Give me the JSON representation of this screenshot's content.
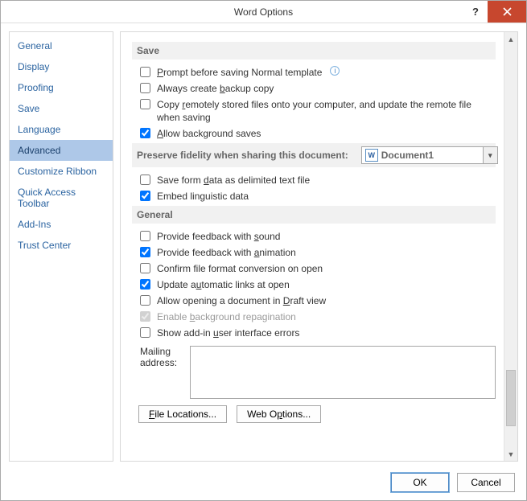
{
  "title": "Word Options",
  "sidebar": {
    "items": [
      {
        "label": "General"
      },
      {
        "label": "Display"
      },
      {
        "label": "Proofing"
      },
      {
        "label": "Save"
      },
      {
        "label": "Language"
      },
      {
        "label": "Advanced",
        "selected": true
      },
      {
        "label": "Customize Ribbon"
      },
      {
        "label": "Quick Access Toolbar"
      },
      {
        "label": "Add-Ins"
      },
      {
        "label": "Trust Center"
      }
    ]
  },
  "sections": {
    "save": {
      "head": "Save",
      "opts": [
        {
          "label": "Prompt before saving Normal template",
          "checked": false,
          "info": true,
          "u": [
            0
          ]
        },
        {
          "label": "Always create backup copy",
          "checked": false,
          "u": [
            14
          ]
        },
        {
          "label": "Copy remotely stored files onto your computer, and update the remote file when saving",
          "checked": false,
          "u": [
            5
          ]
        },
        {
          "label": "Allow background saves",
          "checked": true,
          "u": [
            0
          ]
        }
      ]
    },
    "preserve": {
      "head": "Preserve fidelity when sharing this document:",
      "doc": "Document1",
      "opts": [
        {
          "label": "Save form data as delimited text file",
          "checked": false,
          "u": [
            10
          ]
        },
        {
          "label": "Embed linguistic data",
          "checked": true,
          "u": []
        }
      ]
    },
    "general": {
      "head": "General",
      "opts": [
        {
          "label": "Provide feedback with sound",
          "checked": false,
          "u": [
            22
          ]
        },
        {
          "label": "Provide feedback with animation",
          "checked": true,
          "u": [
            22
          ]
        },
        {
          "label": "Confirm file format conversion on open",
          "checked": false,
          "u": []
        },
        {
          "label": "Update automatic links at open",
          "checked": true,
          "u": [
            8
          ]
        },
        {
          "label": "Allow opening a document in Draft view",
          "checked": false,
          "u": [
            28
          ]
        },
        {
          "label": "Enable background repagination",
          "checked": true,
          "disabled": true,
          "u": [
            7
          ]
        },
        {
          "label": "Show add-in user interface errors",
          "checked": false,
          "u": [
            12
          ]
        }
      ],
      "mailing_label": "Mailing address:",
      "mailing_value": "",
      "file_locations_btn": "File Locations...",
      "web_options_btn": "Web Options..."
    }
  },
  "footer": {
    "ok": "OK",
    "cancel": "Cancel"
  }
}
